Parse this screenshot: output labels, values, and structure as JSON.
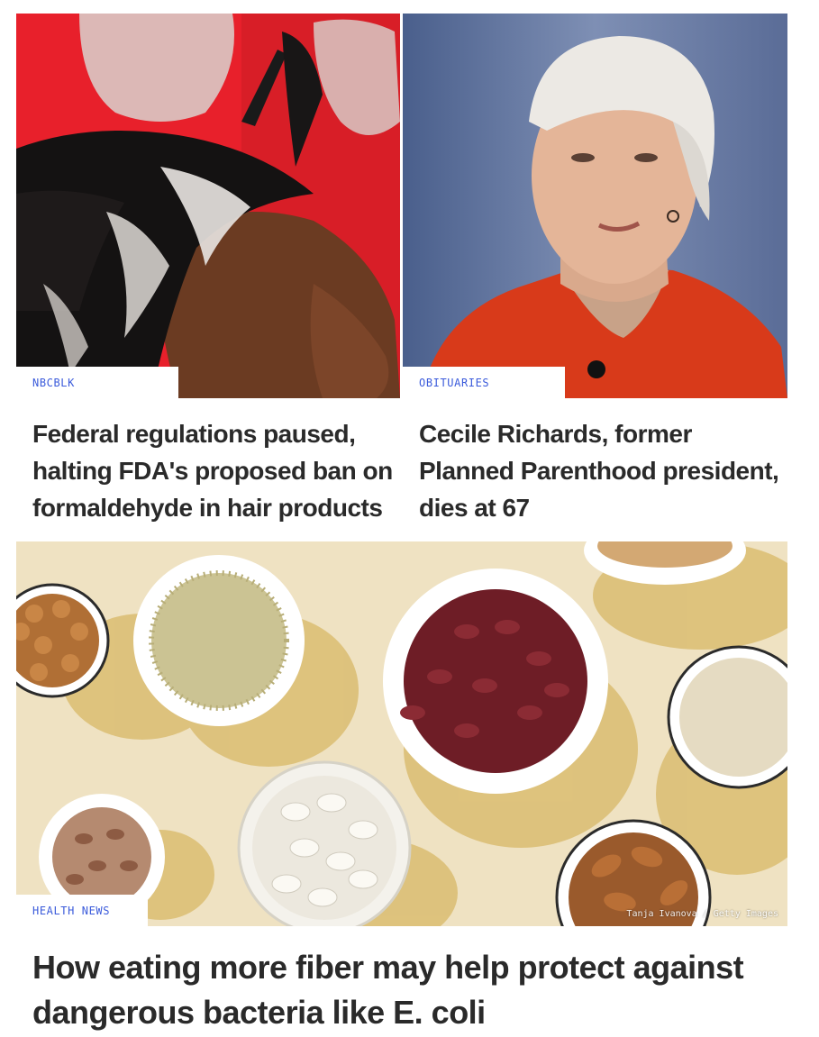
{
  "articles": [
    {
      "category": "NBCBLK",
      "title": "Federal regulations paused, halting FDA's proposed ban on formaldehyde in hair products",
      "image_alt": "Person having hair treatment applied with gloved hands"
    },
    {
      "category": "OBITUARIES",
      "title": "Cecile Richards, former Planned Parenthood president, dies at 67",
      "image_alt": "Woman with short white hair in red blouse"
    },
    {
      "category": "HEALTH NEWS",
      "title": "How eating more fiber may help protect against dangerous bacteria like E. coli",
      "image_alt": "Bowls of beans, nuts and seeds on a beige background",
      "image_credit": "Tanja Ivanova / Getty Images"
    }
  ],
  "colors": {
    "tag_text": "#3b5bdb",
    "headline_text": "#2a2a2a",
    "background": "#ffffff"
  }
}
